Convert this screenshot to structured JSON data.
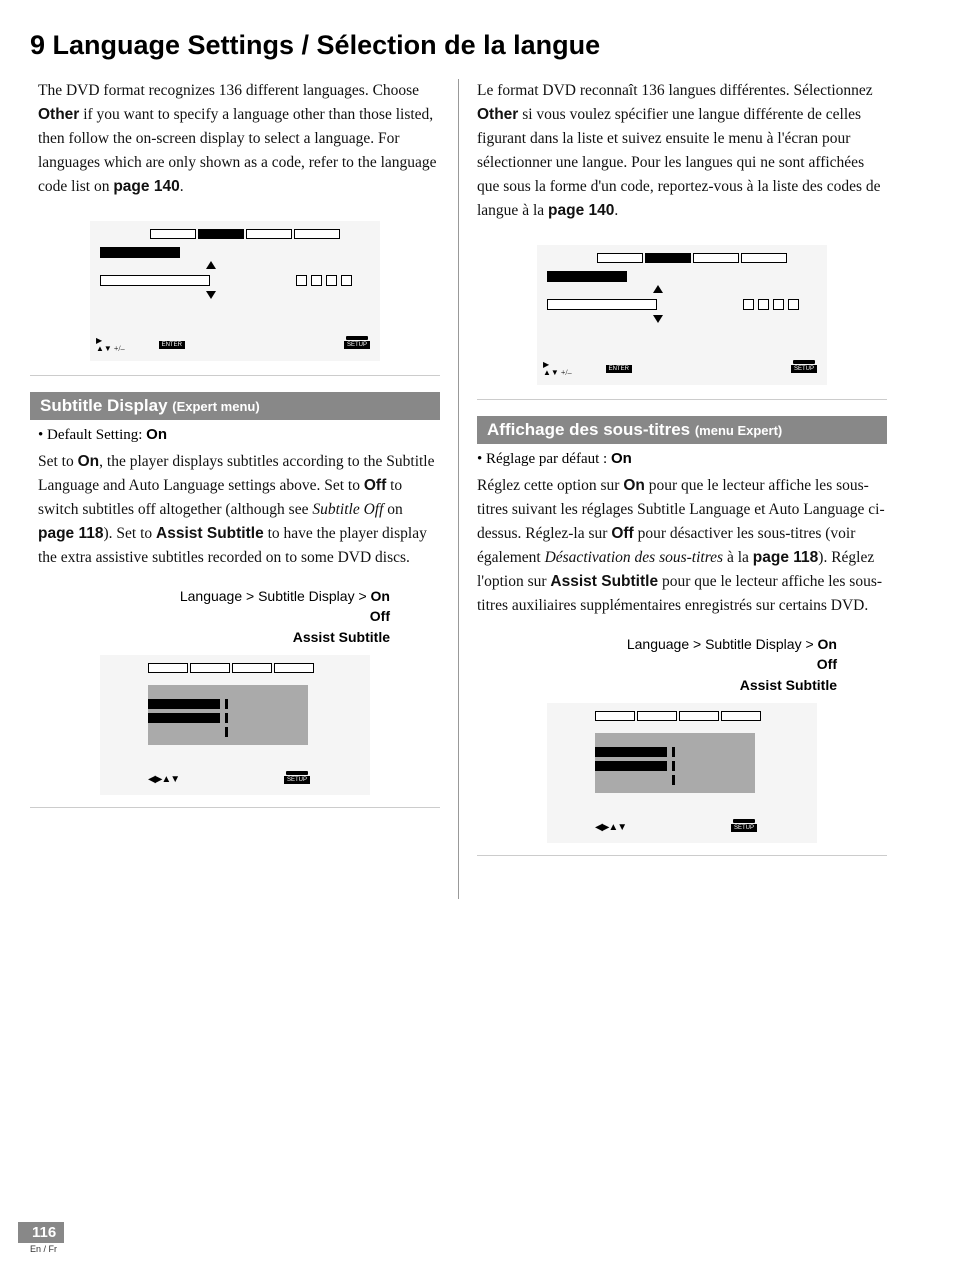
{
  "page": {
    "title": "9 Language Settings / Sélection de la langue",
    "number": "116",
    "langFooter": "En / Fr"
  },
  "en": {
    "intro_1": "The DVD format recognizes 136 different languages. Choose ",
    "intro_other": "Other",
    "intro_2": " if you want to specify a language other than those listed, then follow the on-screen display to select a language. For languages which are only shown as a code, refer to the language code list on ",
    "intro_page": "page 140",
    "intro_3": ".",
    "subhead_main": "Subtitle Display ",
    "subhead_sub": "(Expert menu)",
    "default_label": "• Default Setting: ",
    "default_val": "On",
    "body_1": "Set to ",
    "on": "On",
    "body_2": ", the player displays subtitles according to the Subtitle Language and Auto Language settings above. Set to ",
    "off": "Off",
    "body_3": " to switch subtitles off altogether (although see ",
    "see_ital": "Subtitle Off",
    "body_4": " on ",
    "see_page": "page 118",
    "body_5": "). Set to ",
    "assist": "Assist Subtitle",
    "body_6": " to have the player display the extra assistive subtitles recorded on to some DVD discs.",
    "menu": {
      "path": "Language > Subtitle Display > ",
      "on": "On",
      "off": "Off",
      "assist": "Assist Subtitle"
    }
  },
  "fr": {
    "intro_1": "Le format DVD reconnaît 136 langues différentes. Sélectionnez ",
    "intro_other": "Other",
    "intro_2": " si vous voulez spécifier une langue différente de celles figurant dans la liste et suivez ensuite le menu à l'écran pour sélectionner une langue. Pour les langues qui ne sont affichées que sous la forme d'un code, reportez-vous à la liste des codes de langue à la ",
    "intro_page": "page 140",
    "intro_3": ".",
    "subhead_main": "Affichage des sous-titres ",
    "subhead_sub": "(menu Expert)",
    "default_label": "• Réglage par défaut : ",
    "default_val": "On",
    "body_1": "Réglez cette option sur ",
    "on": "On",
    "body_2": " pour que le lecteur affiche les sous-titres suivant les réglages Subtitle Language et Auto Language ci-dessus. Réglez-la sur ",
    "off": "Off",
    "body_3": " pour désactiver les sous-titres (voir également ",
    "see_ital": "Désactivation des sous-titres",
    "body_4": " à la ",
    "see_page": "page 118",
    "body_5": "). Réglez l'option sur ",
    "assist": "Assist Subtitle",
    "body_6": " pour que le lecteur affiche les sous-titres auxiliaires supplémentaires enregistrés sur certains DVD.",
    "menu": {
      "path": "Language > Subtitle Display > ",
      "on": "On",
      "off": "Off",
      "assist": "Assist Subtitle"
    }
  },
  "icons": {
    "enter": "ENTER",
    "setup": "SETUP"
  }
}
